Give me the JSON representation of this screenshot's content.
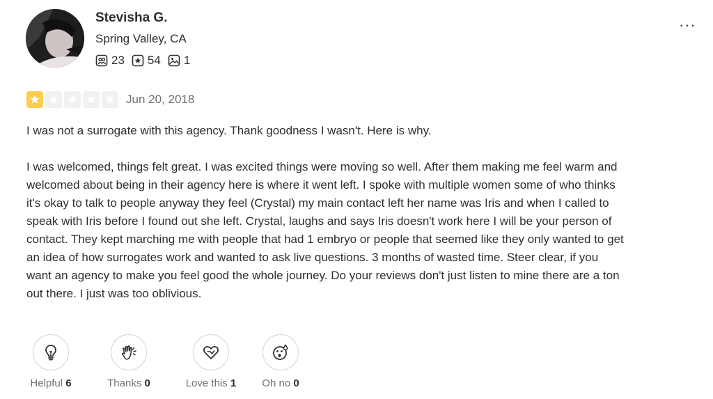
{
  "user": {
    "name": "Stevisha G.",
    "location": "Spring Valley, CA",
    "stats": {
      "friends": "23",
      "reviews": "54",
      "photos": "1"
    }
  },
  "menu": {
    "more_label": "..."
  },
  "review": {
    "rating": 1,
    "rating_max": 5,
    "date": "Jun 20, 2018",
    "paragraphs": [
      "I was not a surrogate with this agency. Thank goodness I wasn't. Here is why.",
      "I was welcomed, things felt great. I was excited things were moving so well. After them making me feel warm and welcomed about being in their agency here is where it went left. I spoke with multiple women some of who thinks it's okay to talk to people anyway they feel (Crystal) my main contact left her name was Iris and when I called to speak with Iris before I found out she left. Crystal, laughs and says Iris doesn't work here I will be your person of contact. They kept marching me with people that had 1 embryo or people that seemed like they only wanted to get an idea of how surrogates work and wanted to ask live questions. 3 months of wasted time. Steer clear, if you want an agency to make you feel good the whole journey. Do your reviews don't just listen to mine there are a ton out there. I just was too oblivious."
    ]
  },
  "reactions": {
    "helpful": {
      "label": "Helpful",
      "count": "6",
      "icon": "lightbulb-icon"
    },
    "thanks": {
      "label": "Thanks",
      "count": "0",
      "icon": "clapping-hands-icon"
    },
    "love": {
      "label": "Love this",
      "count": "1",
      "icon": "heart-icon"
    },
    "ohno": {
      "label": "Oh no",
      "count": "0",
      "icon": "surprised-face-icon"
    }
  },
  "colors": {
    "star_on": "#ffcc4b",
    "star_off": "#f1f1f1",
    "text": "#2d2e2f",
    "muted": "#6e7072"
  }
}
